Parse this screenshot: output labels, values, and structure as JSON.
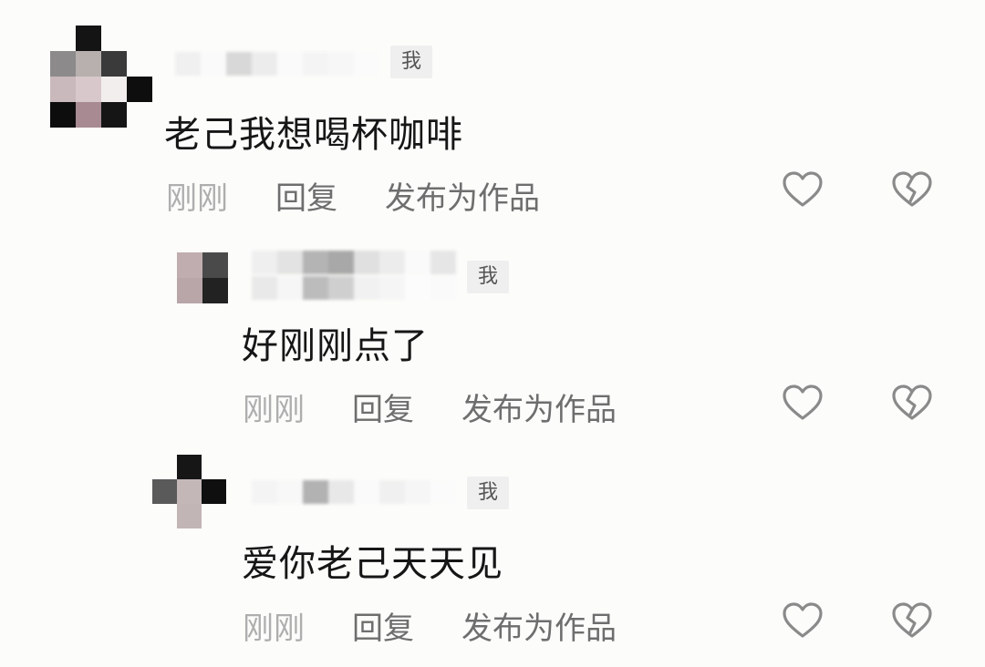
{
  "me_badge": "我",
  "comments": [
    {
      "text": "老己我想喝杯咖啡",
      "time": "刚刚",
      "reply": "回复",
      "publish": "发布为作品"
    },
    {
      "text": "好刚刚点了",
      "time": "刚刚",
      "reply": "回复",
      "publish": "发布为作品"
    },
    {
      "text": "爱你老己天天见",
      "time": "刚刚",
      "reply": "回复",
      "publish": "发布为作品"
    }
  ],
  "icons": {
    "like": "heart-outline-icon",
    "dislike": "broken-heart-icon"
  },
  "colors": {
    "text": "#161616",
    "secondary": "#6e6e6e",
    "timestamp": "#aeaeae",
    "badge_bg": "#efefef",
    "icon_stroke": "#8a8a8a"
  }
}
